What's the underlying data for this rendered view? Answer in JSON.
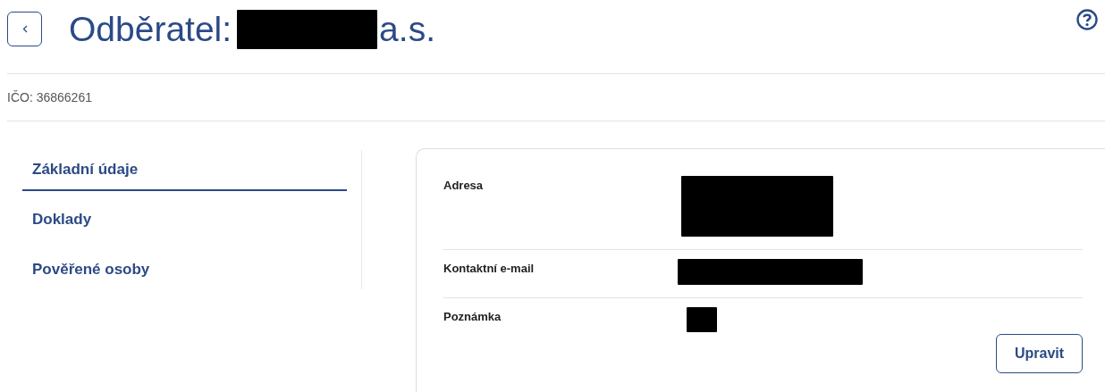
{
  "header": {
    "title_prefix": "Odběratel:",
    "title_suffix": "a.s."
  },
  "ico": "IČO: 36866261",
  "tabs": [
    {
      "label": "Základní údaje",
      "selected": true
    },
    {
      "label": "Doklady",
      "selected": false
    },
    {
      "label": "Pověřené osoby",
      "selected": false
    }
  ],
  "details": [
    {
      "label": "Adresa"
    },
    {
      "label": "Kontaktní e-mail"
    },
    {
      "label": "Poznámka"
    }
  ],
  "buttons": [
    "Upravit"
  ]
}
